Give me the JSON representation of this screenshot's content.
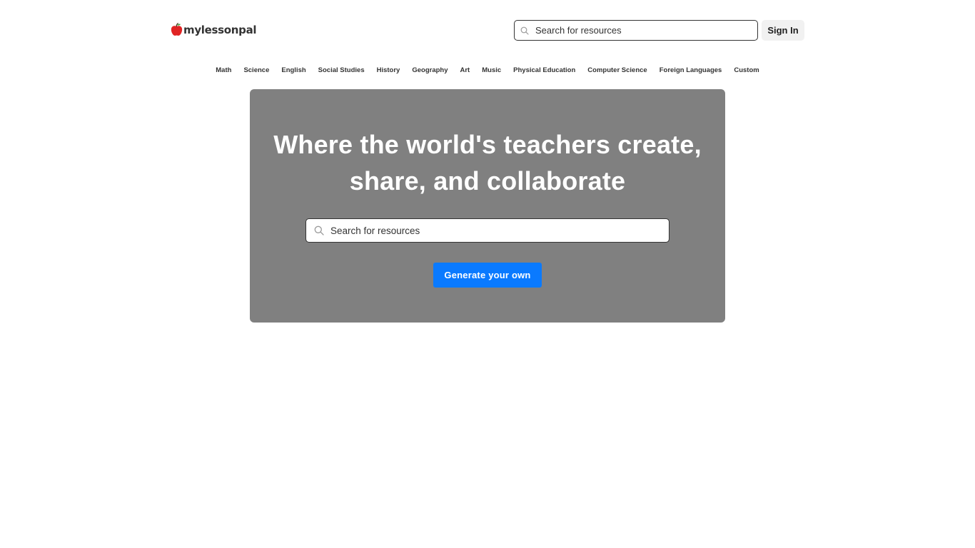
{
  "header": {
    "logo_text": "mylessonpal",
    "search_placeholder": "Search for resources",
    "sign_in_label": "Sign In"
  },
  "subjects": [
    {
      "label": "Math"
    },
    {
      "label": "Science"
    },
    {
      "label": "English"
    },
    {
      "label": "Social Studies"
    },
    {
      "label": "History"
    },
    {
      "label": "Geography"
    },
    {
      "label": "Art"
    },
    {
      "label": "Music"
    },
    {
      "label": "Physical Education"
    },
    {
      "label": "Computer Science"
    },
    {
      "label": "Foreign Languages"
    },
    {
      "label": "Custom"
    }
  ],
  "hero": {
    "title_line1": "Where the world's teachers create,",
    "title_line2": "share, and collaborate",
    "search_placeholder": "Search for resources",
    "generate_label": "Generate your own"
  },
  "colors": {
    "hero_background": "#808080",
    "accent_button": "#0a7aff",
    "logo_apple": "#e02424"
  },
  "icons": {
    "logo": "apple-icon",
    "search": "search-icon"
  }
}
